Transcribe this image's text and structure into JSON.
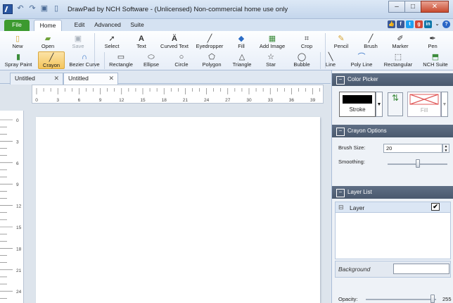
{
  "window": {
    "title": "DrawPad by NCH Software - (Unlicensed) Non-commercial home use only",
    "minimize_icon": "minimize-icon",
    "maximize_icon": "maximize-icon",
    "close_icon": "close-icon"
  },
  "ribbon_tabs": [
    "File",
    "Home",
    "Edit",
    "Advanced",
    "Suite"
  ],
  "toolbar_row1": {
    "new": "New",
    "open": "Open",
    "save": "Save",
    "select": "Select",
    "text": "Text",
    "curved_text": "Curved Text",
    "eyedropper": "Eyedropper",
    "fill": "Fill",
    "add_image": "Add Image",
    "crop": "Crop",
    "pencil": "Pencil",
    "brush": "Brush",
    "marker": "Marker",
    "pen": "Pen"
  },
  "toolbar_row2": {
    "spray_paint": "Spray Paint",
    "crayon": "Crayon",
    "bezier_curve": "Bezier Curve",
    "rectangle": "Rectangle",
    "ellipse": "Ellipse",
    "circle": "Circle",
    "polygon": "Polygon",
    "triangle": "Triangle",
    "star": "Star",
    "bubble": "Bubble",
    "line": "Line",
    "poly_line": "Poly Line",
    "rectangular": "Rectangular",
    "nch_suite": "NCH Suite"
  },
  "doc_tabs": [
    "Untitled",
    "Untitled"
  ],
  "ruler": {
    "h_ticks": [
      "0",
      "3",
      "6",
      "9",
      "12",
      "15",
      "18",
      "21",
      "24",
      "27",
      "30",
      "33",
      "36",
      "39"
    ],
    "v_ticks": [
      "0",
      "3",
      "6",
      "9",
      "12",
      "15",
      "18",
      "21",
      "24"
    ]
  },
  "color_picker": {
    "title": "Color Picker",
    "stroke_label": "Stroke",
    "fill_label": "Fill",
    "stroke_color": "#000000"
  },
  "crayon_options": {
    "title": "Crayon Options",
    "brush_size_label": "Brush Size:",
    "brush_size_value": "20",
    "smoothing_label": "Smoothing:",
    "smoothing_level": 0.5
  },
  "layer_list": {
    "title": "Layer List",
    "layer_name": "Layer",
    "layer_visible": true,
    "background_label": "Background",
    "opacity_label": "Opacity:",
    "opacity_value": "255"
  }
}
